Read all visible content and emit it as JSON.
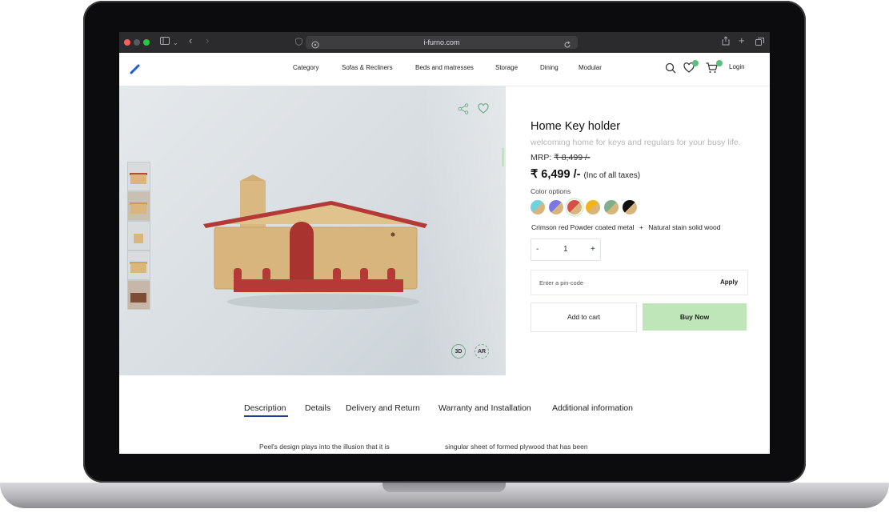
{
  "browser": {
    "url": "i-furno.com",
    "traffic_lights": [
      "#ff5f57",
      "#febc2e",
      "#28c840"
    ]
  },
  "header": {
    "logo_icon": "pen-logo-icon",
    "nav": [
      "Category",
      "Sofas & Recliners",
      "Beds and matresses",
      "Storage",
      "Dining",
      "Modular"
    ],
    "wishlist_count": "0",
    "cart_count": "0",
    "login_label": "Login",
    "badge_color": "#5bbf7a"
  },
  "gallery": {
    "thumbnail_count": 5,
    "badges": [
      "3D",
      "AR"
    ],
    "accent_red": "#b53a37"
  },
  "product": {
    "title": "Home Key holder",
    "subtitle": "welcoming home for keys and regulars for your busy life.",
    "mrp_label": "MRP:",
    "mrp_value": "₹ 8,499 /-",
    "price": "₹ 6,499 /-",
    "price_note": "(Inc of all taxes)",
    "color_options_label": "Color options",
    "swatches": [
      {
        "name": "cyan",
        "color": "#6fd4df"
      },
      {
        "name": "violet",
        "color": "#7b78e4"
      },
      {
        "name": "crimson-red",
        "color": "#d84d45",
        "selected": true
      },
      {
        "name": "yellow",
        "color": "#f2b31b"
      },
      {
        "name": "sage-green",
        "color": "#7fae8a"
      },
      {
        "name": "black",
        "color": "#111111"
      }
    ],
    "swatch_wood_color": "#d8b57c",
    "variant_metal": "Crimson red Powder coated metal",
    "variant_sep": "+",
    "variant_wood": "Natural stain solid wood",
    "qty_minus": "-",
    "qty_value": "1",
    "qty_plus": "+",
    "pin_placeholder": "Enter a pin-code",
    "apply_label": "Apply",
    "add_to_cart": "Add to cart",
    "buy_now": "Buy Now",
    "buy_color": "#bfe6b9"
  },
  "tabs": [
    "Description",
    "Details",
    "Delivery and Return",
    "Warranty and Installation",
    "Additional information"
  ],
  "active_tab_color": "#1d3f8f",
  "description": {
    "col1": "Peel's design plays into the illusion that it is",
    "col2": "singular sheet of formed plywood that has been"
  }
}
